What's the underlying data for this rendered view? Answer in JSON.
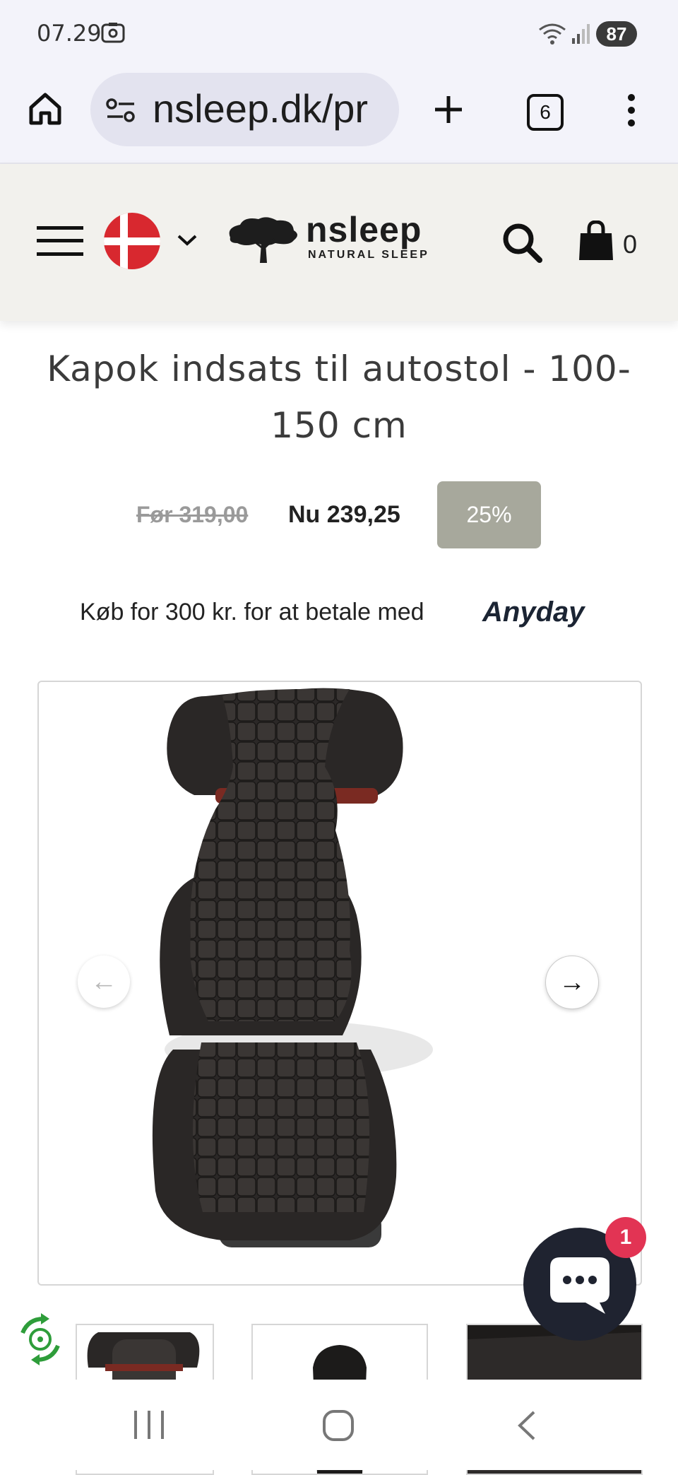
{
  "status_bar": {
    "time": "07.29",
    "battery": "87"
  },
  "browser": {
    "url": "nsleep.dk/pr",
    "tab_count": "6"
  },
  "site_header": {
    "brand_name": "nsleep",
    "brand_tagline": "NATURAL SLEEP",
    "cart_count": "0"
  },
  "product": {
    "title": "Kapok indsats til autostol - 100-150 cm",
    "old_price": "Før 319,00",
    "new_price": "Nu 239,25",
    "discount_badge": "25%",
    "anyday_text": "Køb for 300 kr. for at betale med",
    "anyday_logo": "Anyday"
  },
  "chat": {
    "badge_count": "1"
  },
  "icons": {
    "home": "home-icon",
    "site_settings": "site-settings-icon",
    "new_tab": "plus-icon",
    "tabs": "tabs-icon",
    "more": "more-vert-icon",
    "menu": "hamburger-icon",
    "flag": "denmark-flag-icon",
    "search": "search-icon",
    "cart": "shopping-bag-icon",
    "prev": "arrow-left-icon",
    "next": "arrow-right-icon",
    "chat": "chat-bubble-icon",
    "recycle": "recycle-badge-icon"
  },
  "colors": {
    "discount_bg": "#a7a89c",
    "header_bg": "#f2f1ed",
    "chat_bg": "#1f2330",
    "badge_red": "#e23454",
    "flag_red": "#d8282f"
  }
}
